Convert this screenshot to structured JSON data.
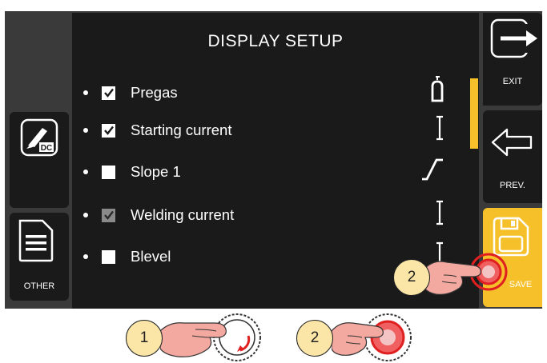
{
  "screen": {
    "title": "DISPLAY SETUP",
    "items": [
      {
        "label": "Pregas",
        "checked": true,
        "icon": "gas-bottle-icon"
      },
      {
        "label": "Starting current",
        "checked": true,
        "icon": "current-bar-icon"
      },
      {
        "label": "Slope 1",
        "checked": false,
        "icon": "slope-icon"
      },
      {
        "label": "Welding current",
        "checked": true,
        "icon": "current-bar-icon"
      },
      {
        "label": "Blevel",
        "checked": false,
        "icon": "current-bar-icon"
      }
    ]
  },
  "right_buttons": {
    "exit_label": "EXIT",
    "prev_label": "PREV.",
    "save_label": "SAVE"
  },
  "left_buttons": {
    "other_label": "OTHER",
    "dc_label": "DC"
  },
  "callouts": {
    "screen_callout": "2",
    "knob_rotate_callout": "1",
    "knob_press_callout": "2"
  },
  "colors": {
    "accent": "#f5c02a",
    "panel": "#1a1a1a",
    "frame": "#3a3a3a",
    "callout": "#fbe6a8",
    "hand": "#f3a8a0"
  }
}
